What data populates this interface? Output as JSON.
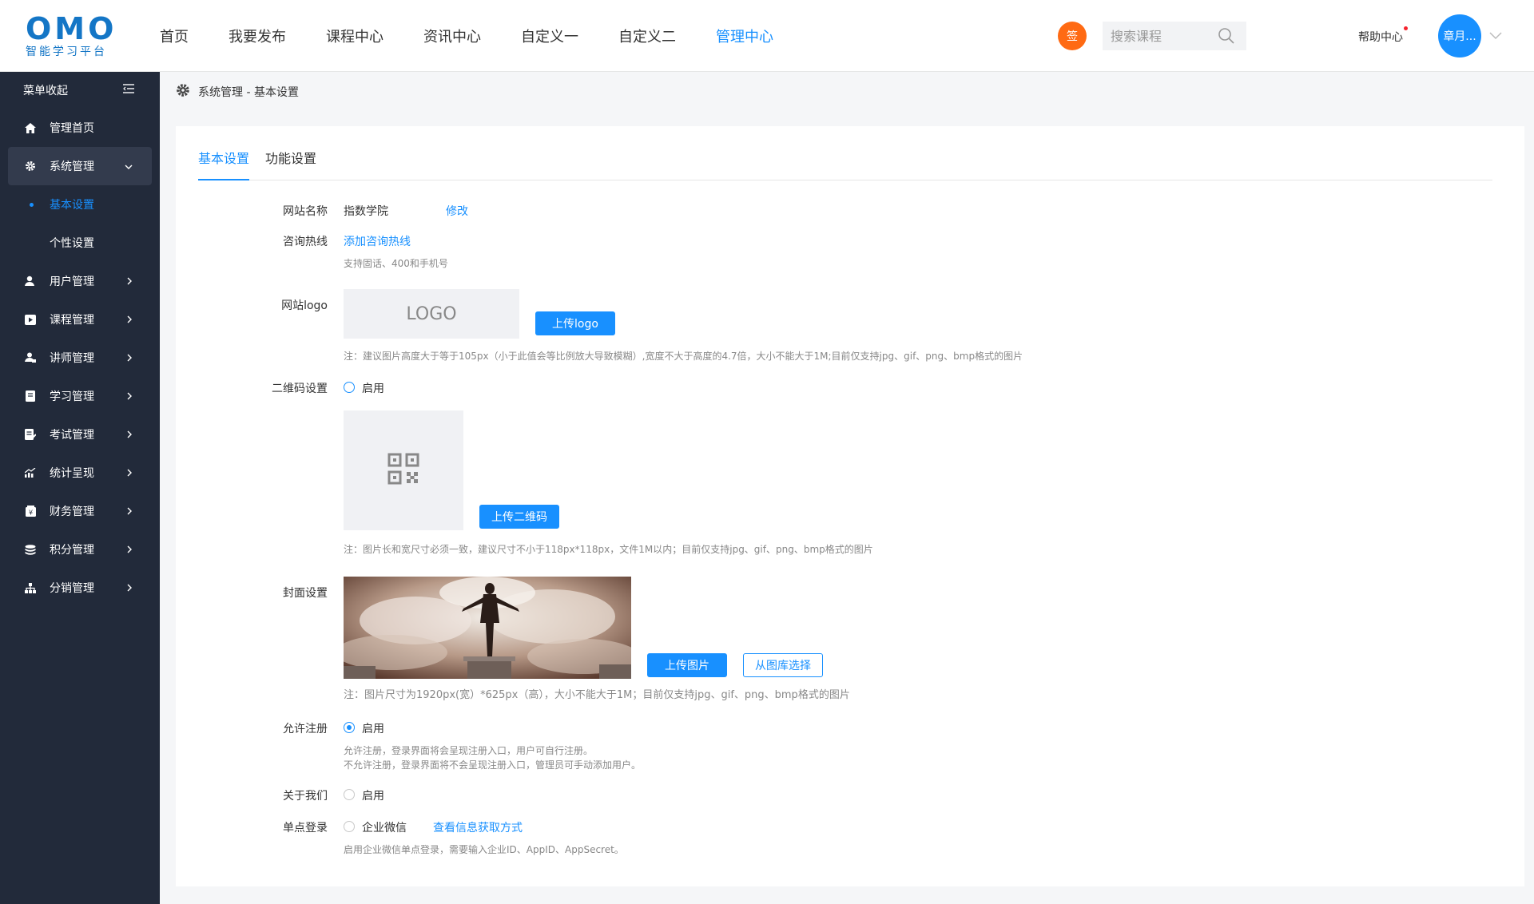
{
  "header": {
    "logo_mark": "OMO",
    "logo_sub": "智能学习平台",
    "nav": [
      "首页",
      "我要发布",
      "课程中心",
      "资讯中心",
      "自定义一",
      "自定义二",
      "管理中心"
    ],
    "nav_active_index": 6,
    "sign_label": "签",
    "search_placeholder": "搜索课程",
    "help_label": "帮助中心",
    "avatar_label": "章月..."
  },
  "sidebar": {
    "toggle_label": "菜单收起",
    "items": [
      {
        "label": "管理首页",
        "icon": "home-icon"
      },
      {
        "label": "系统管理",
        "icon": "gear-icon",
        "open": true
      },
      {
        "label": "用户管理",
        "icon": "user-icon"
      },
      {
        "label": "课程管理",
        "icon": "play-icon"
      },
      {
        "label": "讲师管理",
        "icon": "teacher-icon"
      },
      {
        "label": "学习管理",
        "icon": "book-icon"
      },
      {
        "label": "考试管理",
        "icon": "exam-icon"
      },
      {
        "label": "统计呈现",
        "icon": "stats-icon"
      },
      {
        "label": "财务管理",
        "icon": "finance-icon"
      },
      {
        "label": "积分管理",
        "icon": "coins-icon"
      },
      {
        "label": "分销管理",
        "icon": "org-icon"
      }
    ],
    "sub_items": [
      "基本设置",
      "个性设置"
    ]
  },
  "breadcrumb": "系统管理 - 基本设置",
  "tabs": [
    "基本设置",
    "功能设置"
  ],
  "form": {
    "site_name_label": "网站名称",
    "site_name_value": "指数学院",
    "site_name_edit": "修改",
    "hotline_label": "咨询热线",
    "hotline_add": "添加咨询热线",
    "hotline_note": "支持固话、400和手机号",
    "logo_label": "网站logo",
    "logo_placeholder": "LOGO",
    "logo_upload": "上传logo",
    "logo_note": "注：建议图片高度大于等于105px（小于此值会等比例放大导致模糊）,宽度不大于高度的4.7倍，大小不能大于1M;目前仅支持jpg、gif、png、bmp格式的图片",
    "qr_label": "二维码设置",
    "qr_enable": "启用",
    "qr_upload": "上传二维码",
    "qr_note": "注：图片长和宽尺寸必须一致，建议尺寸不小于118px*118px，文件1M以内；目前仅支持jpg、gif、png、bmp格式的图片",
    "cover_label": "封面设置",
    "cover_upload": "上传图片",
    "cover_library": "从图库选择",
    "cover_note": "注：图片尺寸为1920px(宽）*625px（高），大小不能大于1M；目前仅支持jpg、gif、png、bmp格式的图片",
    "register_label": "允许注册",
    "register_enable": "启用",
    "register_note_1": "允许注册，登录界面将会呈现注册入口，用户可自行注册。",
    "register_note_2": "不允许注册，登录界面将不会呈现注册入口，管理员可手动添加用户。",
    "about_label": "关于我们",
    "about_enable": "启用",
    "sso_label": "单点登录",
    "sso_option": "企业微信",
    "sso_link": "查看信息获取方式",
    "sso_note": "启用企业微信单点登录，需要输入企业ID、AppID、AppSecret。"
  },
  "colors": {
    "primary": "#1890ff",
    "sidebar_bg": "#222a3a",
    "sign_badge": "#ff6a13"
  }
}
